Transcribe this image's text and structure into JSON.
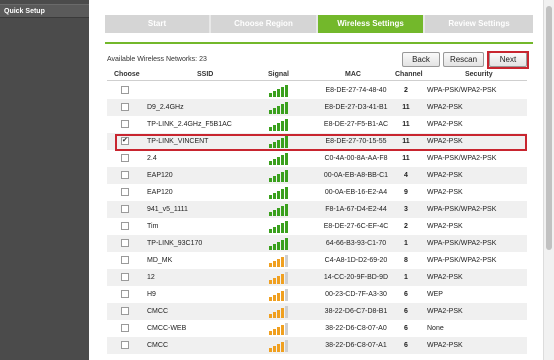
{
  "sidebar": {
    "quick_setup": "Quick Setup"
  },
  "steps": [
    {
      "label": "Start",
      "active": false
    },
    {
      "label": "Choose Region",
      "active": false
    },
    {
      "label": "Wireless Settings",
      "active": true
    },
    {
      "label": "Review Settings",
      "active": false
    }
  ],
  "available": "Available Wireless Networks: 23",
  "buttons": {
    "back": "Back",
    "rescan": "Rescan",
    "next": "Next"
  },
  "table": {
    "headers": {
      "choose": "Choose",
      "ssid": "SSID",
      "signal": "Signal",
      "mac": "MAC",
      "channel": "Channel",
      "security": "Security"
    },
    "rows": [
      {
        "ssid": "",
        "signal_bars": 5,
        "color": "green",
        "mac": "E8-DE-27-74-48-40",
        "channel": "2",
        "security": "WPA-PSK/WPA2-PSK",
        "checked": false
      },
      {
        "ssid": "D9_2.4GHz",
        "signal_bars": 5,
        "color": "green",
        "mac": "E8-DE-27-D3-41-B1",
        "channel": "11",
        "security": "WPA2-PSK",
        "checked": false
      },
      {
        "ssid": "TP-LINK_2.4GHz_F5B1AC",
        "signal_bars": 5,
        "color": "green",
        "mac": "E8-DE-27-F5-B1-AC",
        "channel": "11",
        "security": "WPA2-PSK",
        "checked": false
      },
      {
        "ssid": "TP-LINK_VINCENT",
        "signal_bars": 5,
        "color": "green",
        "mac": "E8-DE-27-70-15-55",
        "channel": "11",
        "security": "WPA2-PSK",
        "checked": true
      },
      {
        "ssid": "2.4",
        "signal_bars": 5,
        "color": "green",
        "mac": "C0-4A-00-8A-AA-F8",
        "channel": "11",
        "security": "WPA-PSK/WPA2-PSK",
        "checked": false
      },
      {
        "ssid": "EAP120",
        "signal_bars": 5,
        "color": "green",
        "mac": "00-0A-EB-A8-BB-C1",
        "channel": "4",
        "security": "WPA2-PSK",
        "checked": false
      },
      {
        "ssid": "EAP120",
        "signal_bars": 5,
        "color": "green",
        "mac": "00-0A-EB-16-E2-A4",
        "channel": "9",
        "security": "WPA2-PSK",
        "checked": false
      },
      {
        "ssid": "941_v5_1111",
        "signal_bars": 5,
        "color": "green",
        "mac": "F8-1A-67-D4-E2-44",
        "channel": "3",
        "security": "WPA-PSK/WPA2-PSK",
        "checked": false
      },
      {
        "ssid": "Tim",
        "signal_bars": 5,
        "color": "green",
        "mac": "E8-DE-27-6C-EF-4C",
        "channel": "2",
        "security": "WPA2-PSK",
        "checked": false
      },
      {
        "ssid": "TP-LINK_93C170",
        "signal_bars": 5,
        "color": "green",
        "mac": "64-66-B3-93-C1-70",
        "channel": "1",
        "security": "WPA-PSK/WPA2-PSK",
        "checked": false
      },
      {
        "ssid": "MD_MK",
        "signal_bars": 4,
        "color": "orange",
        "mac": "C4-A8-1D-D2-69-20",
        "channel": "8",
        "security": "WPA-PSK/WPA2-PSK",
        "checked": false
      },
      {
        "ssid": "12",
        "signal_bars": 4,
        "color": "orange",
        "mac": "14-CC-20-9F-BD-9D",
        "channel": "1",
        "security": "WPA2-PSK",
        "checked": false
      },
      {
        "ssid": "H9",
        "signal_bars": 4,
        "color": "orange",
        "mac": "00-23-CD-7F-A3-30",
        "channel": "6",
        "security": "WEP",
        "checked": false
      },
      {
        "ssid": "CMCC",
        "signal_bars": 4,
        "color": "orange",
        "mac": "38-22-D6-C7-D8-B1",
        "channel": "6",
        "security": "WPA2-PSK",
        "checked": false
      },
      {
        "ssid": "CMCC-WEB",
        "signal_bars": 4,
        "color": "orange",
        "mac": "38-22-D6-C8-07-A0",
        "channel": "6",
        "security": "None",
        "checked": false
      },
      {
        "ssid": "CMCC",
        "signal_bars": 4,
        "color": "orange",
        "mac": "38-22-D6-C8-07-A1",
        "channel": "6",
        "security": "WPA2-PSK",
        "checked": false
      }
    ]
  },
  "colors": {
    "accent_green": "#73b82b",
    "highlight_red": "#c8252f",
    "signal_green": "#3aa01d",
    "signal_orange": "#f0a020"
  }
}
